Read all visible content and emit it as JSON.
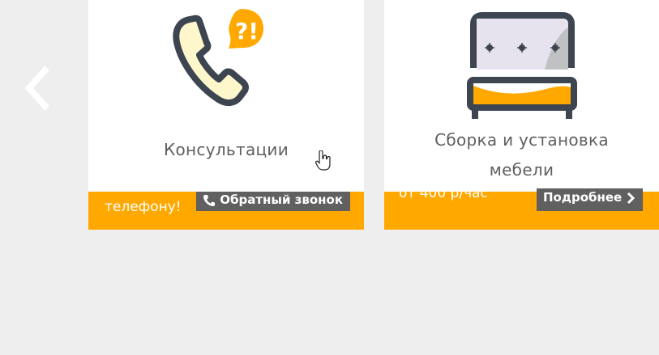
{
  "navigation": {
    "prev_arrow_icon": "chevron-left-icon"
  },
  "cards": [
    {
      "title": "Консультации",
      "icon": "phone-question-icon",
      "footer_text": "телефону!",
      "button_label": "Обратный звонок",
      "button_icon": "phone-icon"
    },
    {
      "title_line1": "Сборка и установка",
      "title_line2": "мебели",
      "icon": "bed-icon",
      "footer_text": "от 400 р/час",
      "button_label": "Подробнее",
      "button_icon": "chevron-right-icon"
    }
  ],
  "colors": {
    "background": "#eeeeee",
    "card": "#ffffff",
    "accent": "#ffa800",
    "button": "#606060",
    "title_text": "#5f5f5f",
    "icon_outline": "#3d4550"
  }
}
